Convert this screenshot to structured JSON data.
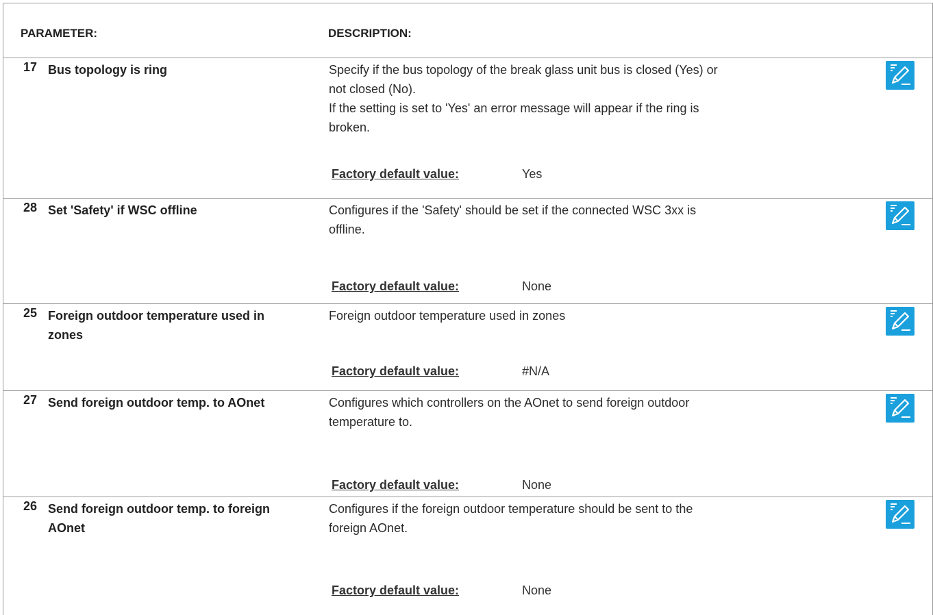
{
  "header": {
    "parameter": "PARAMETER:",
    "description": "DESCRIPTION:"
  },
  "default_label": "Factory default value:",
  "rows": [
    {
      "number": "17",
      "name": "Bus topology is ring",
      "description": "Specify if the bus topology of the break glass unit bus is closed (Yes) or\nnot closed (No).\nIf the setting is set to 'Yes' an error message will appear if the ring is\nbroken.",
      "default_value": "Yes"
    },
    {
      "number": "28",
      "name": "Set 'Safety' if WSC offline",
      "description": "Configures if the 'Safety' should be set if the connected WSC 3xx is\noffline.",
      "default_value": "None"
    },
    {
      "number": "25",
      "name": "Foreign outdoor temperature used in zones",
      "description": "Foreign outdoor temperature used in zones",
      "default_value": "#N/A"
    },
    {
      "number": "27",
      "name": "Send foreign outdoor temp. to AOnet",
      "description": "Configures which controllers on the AOnet to send foreign outdoor\ntemperature to.",
      "default_value": "None"
    },
    {
      "number": "26",
      "name": "Send foreign outdoor temp. to foreign AOnet",
      "description": "Configures if the foreign outdoor temperature should be sent to the\nforeign AOnet.",
      "default_value": "None"
    }
  ],
  "icons": {
    "edit": "edit-pencil-icon"
  },
  "colors": {
    "edit_icon_bg": "#1aa0dc",
    "border": "#9a9a9a"
  }
}
